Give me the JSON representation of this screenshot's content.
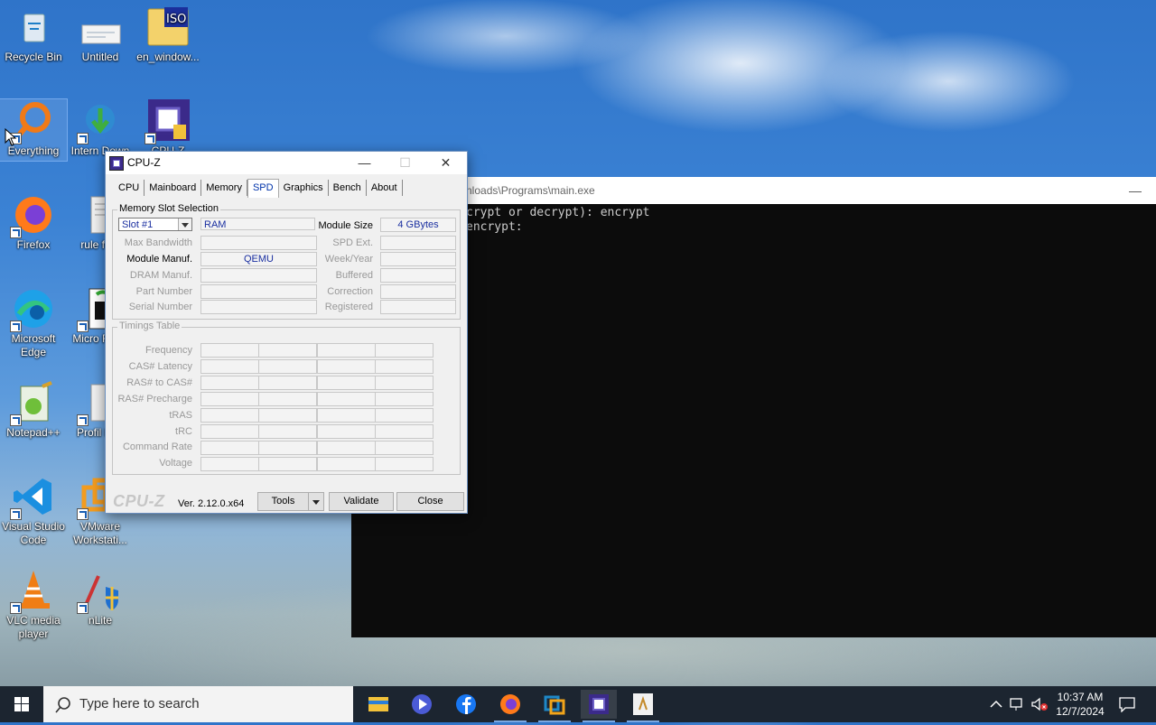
{
  "desktop": {
    "icons": [
      {
        "label": "Recycle Bin"
      },
      {
        "label": "Untitled"
      },
      {
        "label": "en_window..."
      },
      {
        "label": "Everything"
      },
      {
        "label": "Intern Down"
      },
      {
        "label": "CPU-Z"
      },
      {
        "label": "Firefox"
      },
      {
        "label": "rule fork"
      },
      {
        "label": "Microsoft Edge"
      },
      {
        "label": "Micro Read"
      },
      {
        "label": "Notepad++"
      },
      {
        "label": "Profil Edg"
      },
      {
        "label": "Visual Studio Code"
      },
      {
        "label": "VMware Workstati..."
      },
      {
        "label": "VLC media player"
      },
      {
        "label": "nLite"
      }
    ]
  },
  "console": {
    "title": "nloads\\Programs\\main.exe",
    "minimize": "—",
    "lines": [
      "crypt or decrypt): encrypt",
      "encrypt:"
    ]
  },
  "cpuz": {
    "title": "CPU-Z",
    "buttons": {
      "minimize": "—",
      "maximize": "☐",
      "close": "✕"
    },
    "tabs": [
      "CPU",
      "Mainboard",
      "Memory",
      "SPD",
      "Graphics",
      "Bench",
      "About"
    ],
    "active_tab": "SPD",
    "slot_section": "Memory Slot Selection",
    "slot_value": "Slot #1",
    "type_value": "RAM",
    "left_labels": [
      "Max Bandwidth",
      "Module Manuf.",
      "DRAM Manuf.",
      "Part Number",
      "Serial Number"
    ],
    "left_values": [
      "",
      "QEMU",
      "",
      "",
      ""
    ],
    "right_labels": [
      "Module Size",
      "SPD Ext.",
      "Week/Year",
      "Buffered",
      "Correction",
      "Registered"
    ],
    "right_values": [
      "4 GBytes",
      "",
      "",
      "",
      "",
      ""
    ],
    "timings_section": "Timings Table",
    "timing_labels": [
      "Frequency",
      "CAS# Latency",
      "RAS# to CAS#",
      "RAS# Precharge",
      "tRAS",
      "tRC",
      "Command Rate",
      "Voltage"
    ],
    "logo": "CPU-Z",
    "version": "Ver. 2.12.0.x64",
    "footer_buttons": {
      "tools": "Tools",
      "validate": "Validate",
      "close": "Close"
    }
  },
  "taskbar": {
    "search_placeholder": "Type here to search",
    "apps": [
      "file-explorer",
      "media-player",
      "facebook",
      "firefox",
      "virtualbox",
      "cpu-z",
      "main-exe"
    ],
    "time": "10:37 AM",
    "date": "12/7/2024"
  }
}
